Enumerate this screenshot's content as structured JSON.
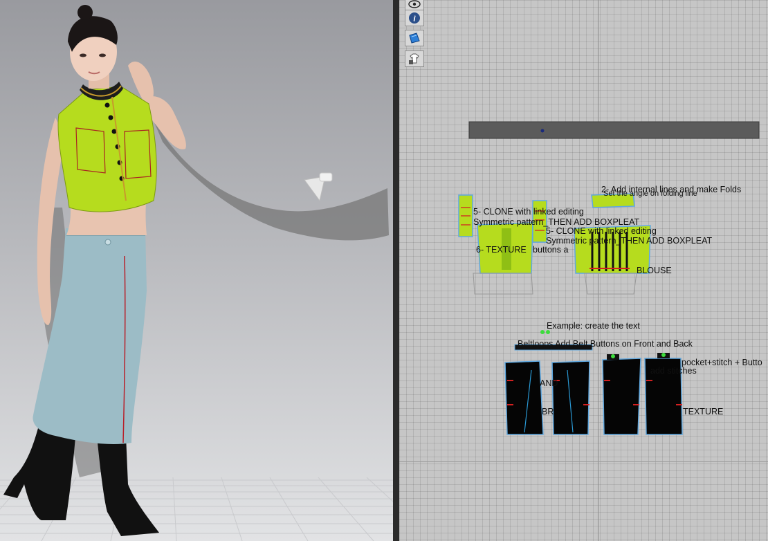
{
  "app": {
    "window": "3D garment simulation and 2D pattern editor"
  },
  "toolbar": {
    "tools": [
      {
        "name": "show-hide-icon"
      },
      {
        "name": "info-icon"
      },
      {
        "name": "fabric-texture-icon"
      },
      {
        "name": "lock-garment-icon"
      }
    ]
  },
  "pattern_labels": {
    "add_internal_lines": "2- Add internal lines and make Folds",
    "fold_line": "Set the angle on folding line",
    "clone_linked": "5- CLONE with linked editing",
    "symmetric_boxpleat": "Symmetric pattern_THEN ADD BOXPLEAT",
    "clone_linked_2": "5- CLONE with linked editing",
    "symmetric_boxpleat_2": "Symmetric pattern_THEN ADD BOXPLEAT",
    "buttons": "buttons a",
    "texture": "6- TEXTURE",
    "blouse": "BLOUSE",
    "example_create": "Example: create the text",
    "beltloops": "Beltloops  Add Belt Buttons on Front and Back",
    "pocket_stitch": "pocket+stitch + Butto",
    "add_stitches": "add stitches",
    "and": "AND",
    "texture_bottom": "TEXTURE",
    "br": "BR"
  },
  "colors": {
    "blouse_fabric": "#b6dc1e",
    "skirt_fabric": "#9cbcc6",
    "pattern_black": "#050505",
    "selection_blue": "#5fa8e0",
    "stitch_red": "#d42020"
  }
}
